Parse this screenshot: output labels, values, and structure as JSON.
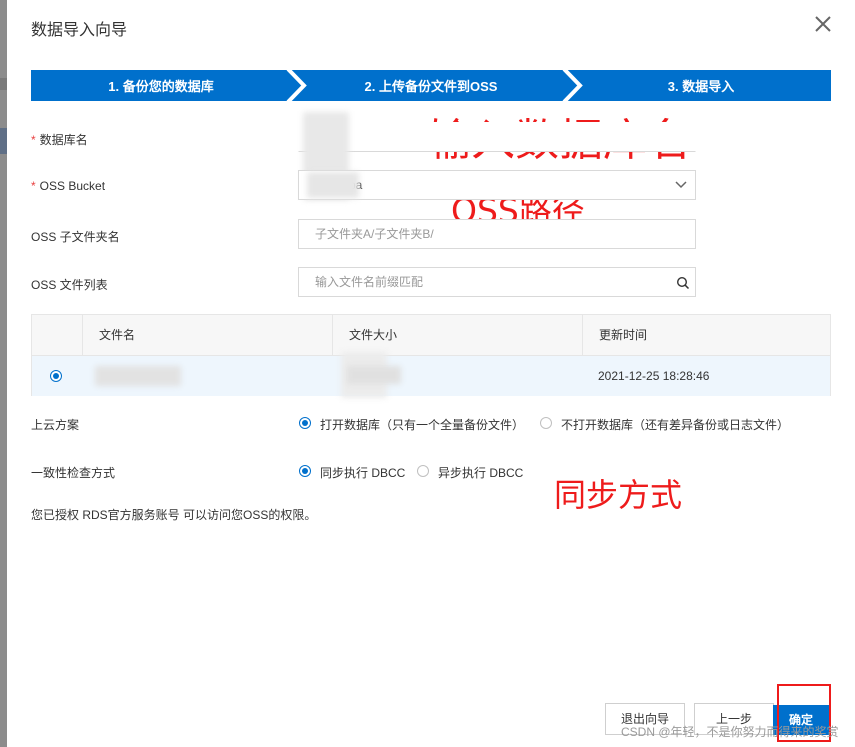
{
  "dialog": {
    "title": "数据导入向导",
    "close_icon": "close-icon"
  },
  "steps": [
    {
      "label": "1. 备份您的数据库"
    },
    {
      "label": "2. 上传备份文件到OSS"
    },
    {
      "label": "3. 数据导入"
    }
  ],
  "form": {
    "db_name": {
      "label": "数据库名",
      "required_mark": "*",
      "value": ""
    },
    "oss_bucket": {
      "label": "OSS Bucket",
      "required_mark": "*",
      "value": "pa"
    },
    "oss_subfolder": {
      "label": "OSS 子文件夹名",
      "placeholder": "子文件夹A/子文件夹B/"
    },
    "oss_file_list": {
      "label": "OSS 文件列表",
      "placeholder": "输入文件名前缀匹配"
    }
  },
  "table": {
    "headers": [
      "文件名",
      "文件大小",
      "更新时间"
    ],
    "rows": [
      {
        "selected": true,
        "name": "",
        "size": "",
        "updated": "2021-12-25 18:28:46"
      }
    ]
  },
  "migration_plan": {
    "label": "上云方案",
    "options": [
      {
        "label": "打开数据库（只有一个全量备份文件）",
        "selected": true
      },
      {
        "label": "不打开数据库（还有差异备份或日志文件）",
        "selected": false
      }
    ]
  },
  "consistency_check": {
    "label": "一致性检查方式",
    "options": [
      {
        "label": "同步执行 DBCC",
        "selected": true
      },
      {
        "label": "异步执行 DBCC",
        "selected": false
      }
    ]
  },
  "note": "您已授权 RDS官方服务账号 可以访问您OSS的权限。",
  "annotations": {
    "db_name_hint": "输入数据库名",
    "oss_path_hint": "OSS路径",
    "sync_hint": "同步方式"
  },
  "buttons": {
    "exit": "退出向导",
    "prev": "上一步",
    "ok": "确定"
  },
  "watermark": "CSDN @年轻，不是你努力而得来的奖赏",
  "colors": {
    "primary": "#0070cc",
    "annotation_red": "#ee1b1b"
  }
}
